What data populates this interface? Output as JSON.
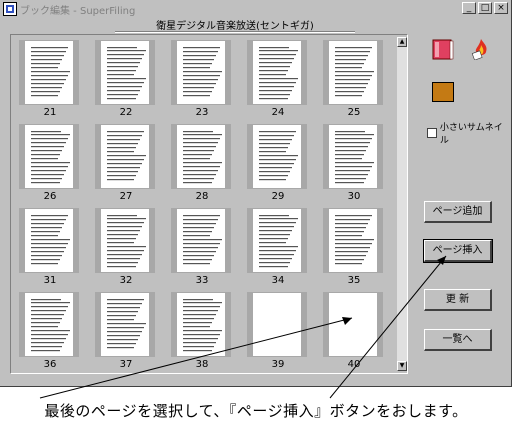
{
  "window": {
    "title": "ブック編集 - SuperFiling",
    "buttons": {
      "minimize": "_",
      "maximize": "□",
      "close": "×"
    }
  },
  "book_title": "衛星デジタル音楽放送(セントギガ)",
  "pages": [
    {
      "num": "21"
    },
    {
      "num": "22"
    },
    {
      "num": "23"
    },
    {
      "num": "24"
    },
    {
      "num": "25"
    },
    {
      "num": "26"
    },
    {
      "num": "27"
    },
    {
      "num": "28"
    },
    {
      "num": "29"
    },
    {
      "num": "30"
    },
    {
      "num": "31"
    },
    {
      "num": "32"
    },
    {
      "num": "33"
    },
    {
      "num": "34"
    },
    {
      "num": "35"
    },
    {
      "num": "36"
    },
    {
      "num": "37"
    },
    {
      "num": "38"
    },
    {
      "num": "39"
    },
    {
      "num": "40"
    }
  ],
  "selected_page": "40",
  "side_panel": {
    "small_thumb_label": "小さいサムネイル",
    "small_thumb_checked": false,
    "add_page": "ページ追加",
    "insert_page": "ページ挿入",
    "update": "更 新",
    "list": "一覧へ"
  },
  "caption": "最後のページを選択して、『ページ挿入』ボタンをおします。"
}
